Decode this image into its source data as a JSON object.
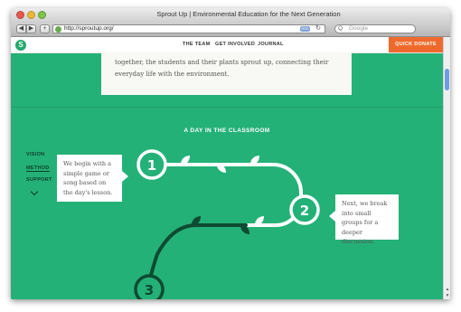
{
  "window": {
    "title": "Sprout Up | Environmental Education for the Next Generation"
  },
  "toolbar": {
    "back_icon": "back-arrow-icon",
    "forward_icon": "forward-arrow-icon",
    "add_icon": "plus-icon",
    "url": "http://sproutup.org/",
    "search_placeholder": "Google",
    "search_icon": "magnifier-icon"
  },
  "nav": {
    "logo_glyph": "S",
    "links": [
      "THE TEAM",
      "GET INVOLVED",
      "JOURNAL"
    ],
    "donate_label": "QUICK DONATE"
  },
  "intro": {
    "line1": "together, the students and their plants sprout up, connecting their",
    "line2": "everyday life with the environment."
  },
  "section": {
    "title": "A DAY IN THE CLASSROOM"
  },
  "side_nav": {
    "items": [
      "VISION",
      "METHOD",
      "SUPPORT"
    ],
    "active": "METHOD"
  },
  "steps": [
    {
      "number": "1",
      "text": "We begin with a simple game or song based on the day's lesson."
    },
    {
      "number": "2",
      "text": "Next, we break into small groups for a deeper discussion."
    },
    {
      "number": "3",
      "text": ""
    }
  ],
  "colors": {
    "page_green": "#24b177",
    "dark_green": "#0f4a32",
    "donate_orange": "#ee6a2c",
    "white": "#ffffff"
  }
}
